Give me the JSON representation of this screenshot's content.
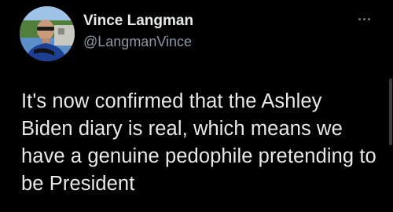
{
  "tweet": {
    "author": {
      "display_name": "Vince Langman",
      "handle": "@LangmanVince",
      "avatar_icon": "profile-photo"
    },
    "more_icon": "more-options-icon",
    "text": "It's now confirmed that the Ashley Biden diary is real, which means we have a genuine pedophile pretending to be President"
  },
  "colors": {
    "background": "#000000",
    "primary_text": "#e7e9ea",
    "secondary_text": "#8b98a5"
  }
}
